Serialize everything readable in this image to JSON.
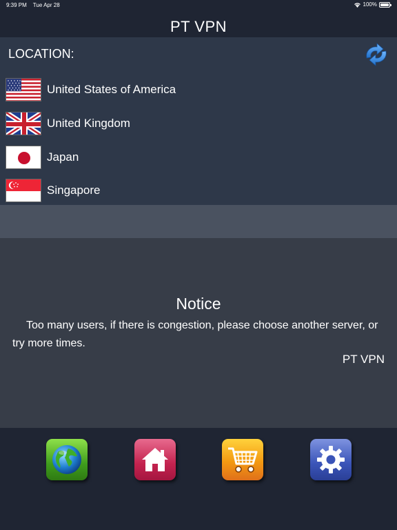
{
  "status_bar": {
    "time": "9:39 PM",
    "date": "Tue Apr 28",
    "battery": "100%"
  },
  "app": {
    "title": "PT  VPN"
  },
  "location": {
    "header": "LOCATION:",
    "servers": [
      {
        "name": "United States of America",
        "flag": "us-flag-icon"
      },
      {
        "name": "United Kingdom",
        "flag": "uk-flag-icon"
      },
      {
        "name": "Japan",
        "flag": "japan-flag-icon"
      },
      {
        "name": "Singapore",
        "flag": "singapore-flag-icon"
      }
    ]
  },
  "notice": {
    "title": "Notice",
    "text": "Too many users, if there is congestion, please choose another server, or try more times.",
    "signature": "PT  VPN"
  },
  "tabs": [
    {
      "icon": "globe-icon",
      "color": "#3f9d1d"
    },
    {
      "icon": "home-icon",
      "color": "#c4234f"
    },
    {
      "icon": "cart-icon",
      "color": "#f39a12"
    },
    {
      "icon": "gear-icon",
      "color": "#3a54b8"
    }
  ],
  "colors": {
    "background": "#1f2533",
    "location_panel": "#2e3849",
    "notice_panel": "#373d48",
    "accent_blue": "#2f7fd4"
  }
}
